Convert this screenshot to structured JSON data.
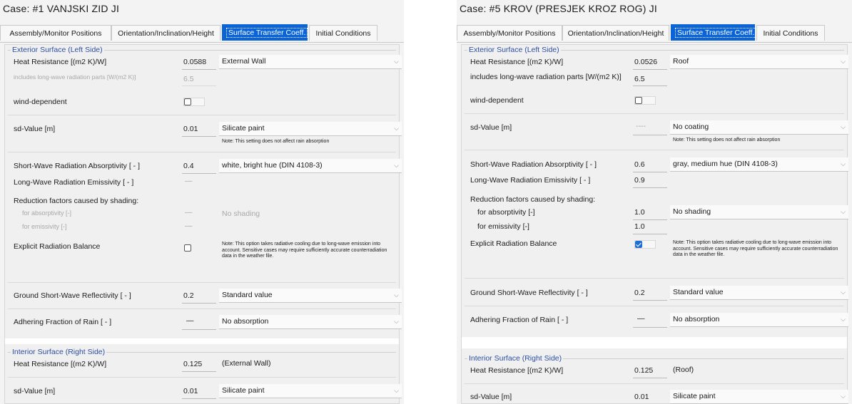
{
  "tabs": [
    "Assembly/Monitor Positions",
    "Orientation/Inclination/Height",
    "Surface Transfer Coeff.",
    "Initial Conditions"
  ],
  "exterior_group": "Exterior Surface (Left Side)",
  "interior_group": "Interior Surface (Right Side)",
  "labels": {
    "heat_resistance": "Heat Resistance [(m2 K)/W]",
    "long_wave_parts": "includes long-wave radiation parts [W/(m2 K)]",
    "wind_dependent": "wind-dependent",
    "sd_value": "sd-Value  [m]",
    "sd_note": "Note: This setting does not affect rain absorption",
    "sw_absorptivity": "Short-Wave Radiation Absorptivity [ - ]",
    "lw_emissivity": "Long-Wave Radiation Emissivity [ - ]",
    "reduction_factors": "Reduction factors caused by shading:",
    "for_absorptivity": "for absorptivity [-]",
    "for_emissivity": "for emissivity [-]",
    "explicit_balance": "Explicit Radiation Balance",
    "explicit_note": "Note: This option takes radiative cooling due to long-wave emission into account. Sensitive cases may require sufficiently accurate counterradiation data in the weather file.",
    "ground_reflectivity": "Ground Short-Wave Reflectivity [ - ]",
    "adhering_rain": "Adhering Fraction of Rain [ - ]",
    "int_heat_resistance": "Heat Resistance [(m2 K)/W]",
    "int_sd_value": "sd-Value  [m]"
  },
  "panels": [
    {
      "case_title": "Case:  #1 VANJSKI ZID JI",
      "heat_resistance": "0.0588",
      "heat_resistance_type": "External Wall",
      "long_wave_parts": "6.5",
      "wind_dependent": false,
      "sd_value": "0.01",
      "sd_type": "Silicate paint",
      "sw_absorptivity": "0.4",
      "sw_type": "white, bright hue (DIN 4108-3)",
      "lw_emissivity": "—",
      "for_absorptivity": "—",
      "for_emissivity": "—",
      "shading_type": "No shading",
      "explicit_balance": false,
      "ground_reflectivity": "0.2",
      "ground_type": "Standard value",
      "adhering_rain": "—",
      "rain_type": "No absorption",
      "int_heat_resistance": "0.125",
      "int_heat_type": "(External Wall)",
      "int_sd_value": "0.01",
      "int_sd_type": "Silicate paint"
    },
    {
      "case_title": "Case:  #5 KROV (PRESJEK KROZ ROG) JI",
      "heat_resistance": "0.0526",
      "heat_resistance_type": "Roof",
      "long_wave_parts": "6.5",
      "wind_dependent": false,
      "sd_value": "----",
      "sd_type": "No coating",
      "sw_absorptivity": "0.6",
      "sw_type": "gray, medium hue (DIN 4108-3)",
      "lw_emissivity": "0.9",
      "for_absorptivity": "1.0",
      "for_emissivity": "1.0",
      "shading_type": "No shading",
      "explicit_balance": true,
      "ground_reflectivity": "0.2",
      "ground_type": "Standard value",
      "adhering_rain": "—",
      "rain_type": "No absorption",
      "int_heat_resistance": "0.125",
      "int_heat_type": "(Roof)",
      "int_sd_value": "0.01",
      "int_sd_type": "Silicate paint"
    }
  ]
}
